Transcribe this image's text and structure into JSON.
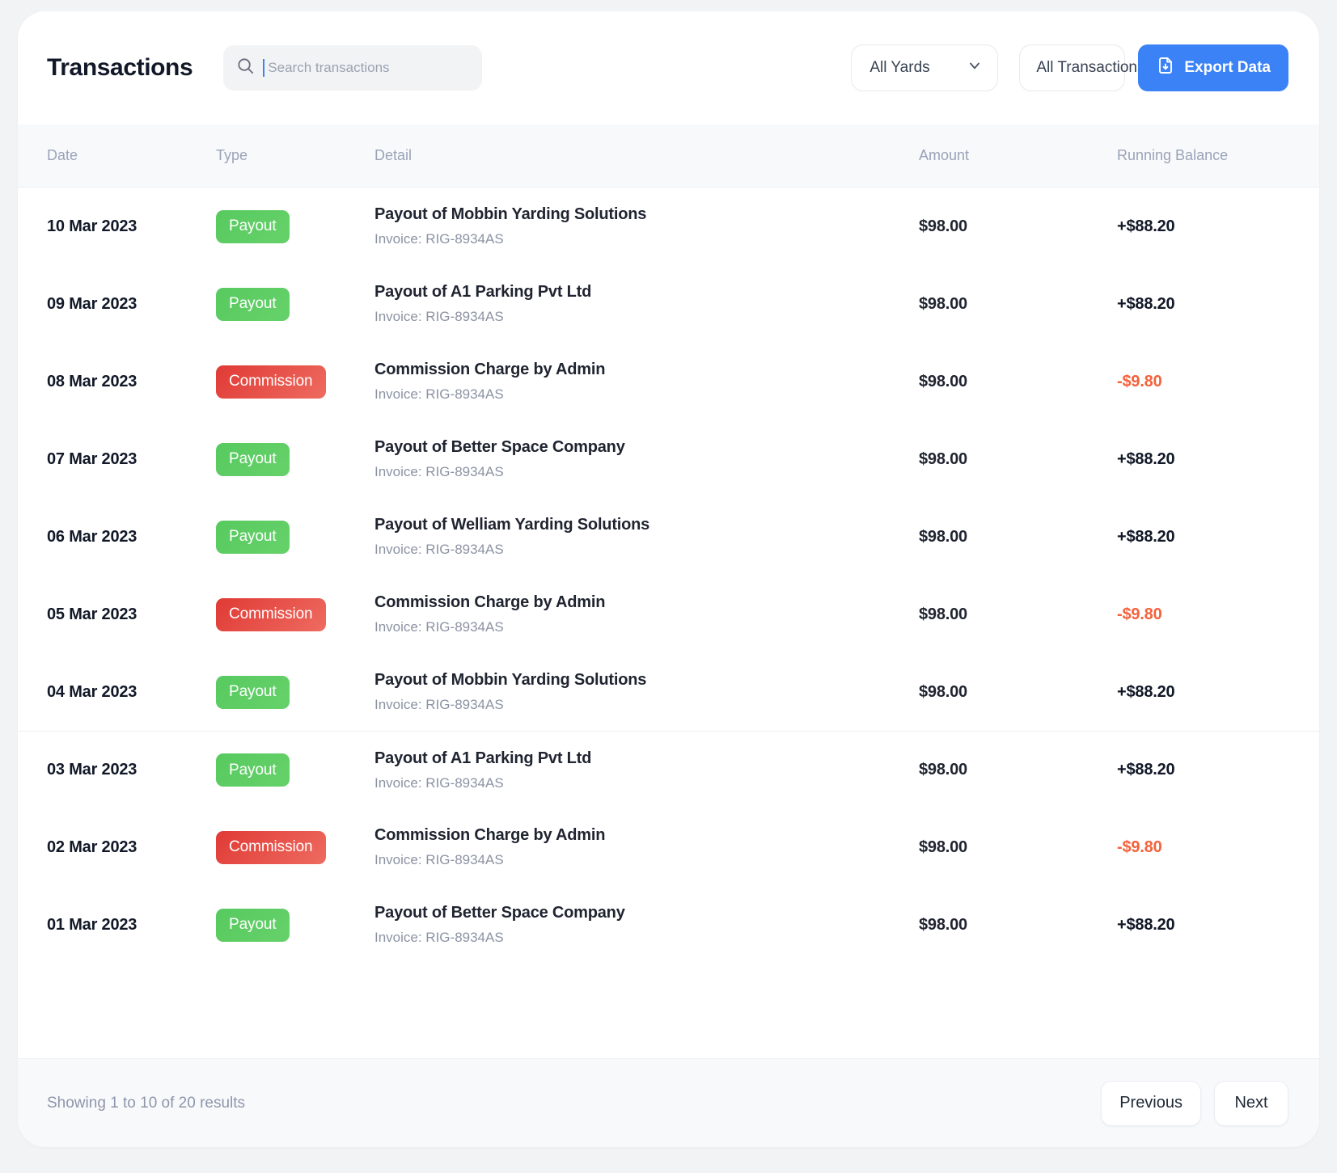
{
  "header": {
    "title": "Transactions",
    "search": {
      "placeholder": "Search transactions",
      "value": "",
      "icon": "search-icon"
    },
    "yards_filter": {
      "label": "All Yards",
      "icon": "chevron-down-icon"
    },
    "type_filter": {
      "label": "All Transactions",
      "icon": "chevron-down-icon"
    },
    "export_button": {
      "label": "Export Data",
      "icon": "file-download-icon"
    }
  },
  "table": {
    "columns": [
      "Date",
      "Type",
      "Detail",
      "Amount",
      "Running Balance"
    ],
    "rows": [
      {
        "date": "10 Mar 2023",
        "type": "Payout",
        "type_kind": "payout",
        "detail": "Payout of Mobbin Yarding Solutions",
        "invoice": "Invoice: RIG-8934AS",
        "amount": "$98.00",
        "balance": "+$88.20",
        "balance_kind": "positive"
      },
      {
        "date": "09 Mar 2023",
        "type": "Payout",
        "type_kind": "payout",
        "detail": "Payout of A1 Parking Pvt Ltd",
        "invoice": "Invoice: RIG-8934AS",
        "amount": "$98.00",
        "balance": "+$88.20",
        "balance_kind": "positive"
      },
      {
        "date": "08 Mar 2023",
        "type": "Commission",
        "type_kind": "commission",
        "detail": "Commission Charge by Admin",
        "invoice": "Invoice: RIG-8934AS",
        "amount": "$98.00",
        "balance": "-$9.80",
        "balance_kind": "negative"
      },
      {
        "date": "07 Mar 2023",
        "type": "Payout",
        "type_kind": "payout",
        "detail": "Payout of Better Space Company",
        "invoice": "Invoice: RIG-8934AS",
        "amount": "$98.00",
        "balance": "+$88.20",
        "balance_kind": "positive"
      },
      {
        "date": "06 Mar 2023",
        "type": "Payout",
        "type_kind": "payout",
        "detail": "Payout of Welliam Yarding Solutions",
        "invoice": "Invoice: RIG-8934AS",
        "amount": "$98.00",
        "balance": "+$88.20",
        "balance_kind": "positive"
      },
      {
        "date": "05 Mar 2023",
        "type": "Commission",
        "type_kind": "commission",
        "detail": "Commission Charge by Admin",
        "invoice": "Invoice: RIG-8934AS",
        "amount": "$98.00",
        "balance": "-$9.80",
        "balance_kind": "negative"
      },
      {
        "date": "04 Mar 2023",
        "type": "Payout",
        "type_kind": "payout",
        "detail": "Payout of Mobbin Yarding Solutions",
        "invoice": "Invoice: RIG-8934AS",
        "amount": "$98.00",
        "balance": "+$88.20",
        "balance_kind": "positive"
      },
      {
        "date": "03 Mar 2023",
        "type": "Payout",
        "type_kind": "payout",
        "detail": "Payout of A1 Parking Pvt Ltd",
        "invoice": "Invoice: RIG-8934AS",
        "amount": "$98.00",
        "balance": "+$88.20",
        "balance_kind": "positive",
        "divider_above": true
      },
      {
        "date": "02 Mar 2023",
        "type": "Commission",
        "type_kind": "commission",
        "detail": "Commission Charge by Admin",
        "invoice": "Invoice: RIG-8934AS",
        "amount": "$98.00",
        "balance": "-$9.80",
        "balance_kind": "negative"
      },
      {
        "date": "01 Mar 2023",
        "type": "Payout",
        "type_kind": "payout",
        "detail": "Payout of Better Space Company",
        "invoice": "Invoice: RIG-8934AS",
        "amount": "$98.00",
        "balance": "+$88.20",
        "balance_kind": "positive"
      }
    ]
  },
  "footer": {
    "results_text": "Showing 1 to 10 of 20 results",
    "previous_label": "Previous",
    "next_label": "Next"
  },
  "colors": {
    "accent_blue": "#3b82f6",
    "payout_green": "#5ecd63",
    "commission_red": "#e5463f",
    "negative_orange": "#f4623c",
    "page_bg": "#f2f3f5"
  }
}
